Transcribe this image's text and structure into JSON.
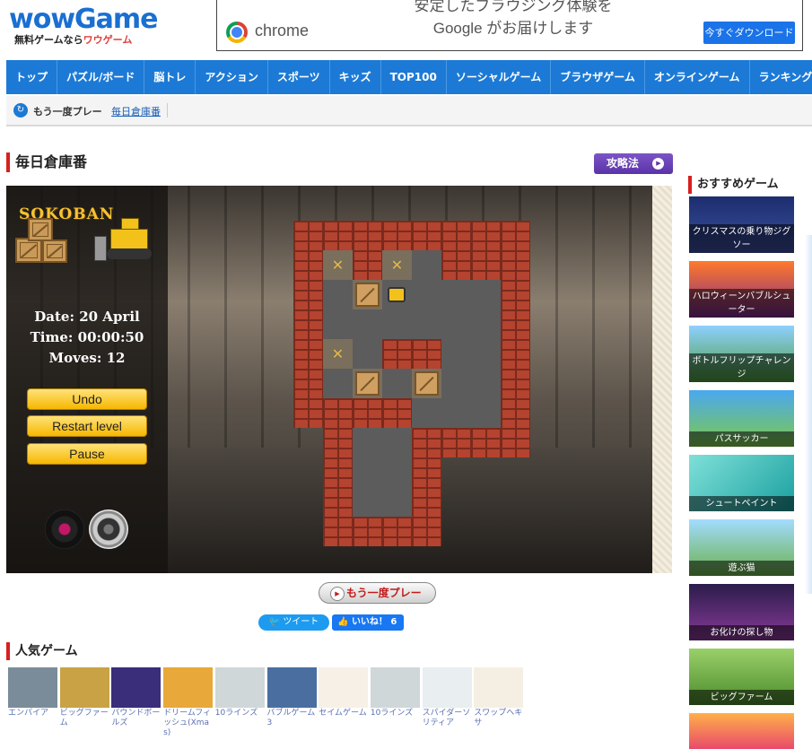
{
  "header": {
    "logo_main": "wowGame",
    "logo_sub_a": "無料ゲームなら",
    "logo_sub_b": "ワウゲーム"
  },
  "ad": {
    "brand": "chrome",
    "text": "安定したブラウジング体験を Google がお届けします",
    "button": "今すぐダウンロード"
  },
  "nav": [
    "トップ",
    "パズル/ボード",
    "脳トレ",
    "アクション",
    "スポーツ",
    "キッズ",
    "TOP100",
    "ソーシャルゲーム",
    "ブラウザゲーム",
    "オンラインゲーム",
    "ランキングゲーム"
  ],
  "subnav": {
    "replay_label": "もう一度プレー",
    "crumb": "毎日倉庫番"
  },
  "page": {
    "title": "毎日倉庫番",
    "guide_button": "攻略法"
  },
  "game": {
    "logo": "SOKOBAN",
    "date": "Date: 20 April",
    "time": "Time: 00:00:50",
    "moves": "Moves: 12",
    "buttons": {
      "undo": "Undo",
      "restart": "Restart level",
      "pause": "Pause"
    },
    "map": [
      "WWWWWWWW..",
      "WTWTFWWW..",
      "WFBPFFFW..",
      "WFFFFFFW..",
      "WTFWWFFW..",
      "WFBFBFFW..",
      "WWWWFFFW..",
      ".WFFWWWW..",
      ".WFFW.....",
      ".WFFW.....",
      ".WWWW....."
    ]
  },
  "below": {
    "replay": "もう一度プレー",
    "tweet": "ツイート",
    "like": "いいね！ 6"
  },
  "popular": {
    "title": "人気ゲーム",
    "items": [
      "エンパイア",
      "ビッグファーム",
      "バウンドボールズ",
      "ドリームフィッシュ(Xmas)",
      "10ラインズ",
      "バブルゲーム3",
      "セイムゲーム",
      "10ラインズ",
      "スパイダーソリティア",
      "スワップヘキサ"
    ]
  },
  "recommended": {
    "title": "おすすめゲーム",
    "items": [
      "クリスマスの乗り物ジグソー",
      "ハロウィーンバブルシューター",
      "ボトルフリップチャレンジ",
      "パスサッカー",
      "シュートペイント",
      "遊ぶ猫",
      "お化けの探し物",
      "ビッグファーム",
      ""
    ]
  },
  "colors": {
    "nav": "#1c7ad6",
    "accent_red": "#d71f1f",
    "button_yellow": "#f6b700"
  }
}
